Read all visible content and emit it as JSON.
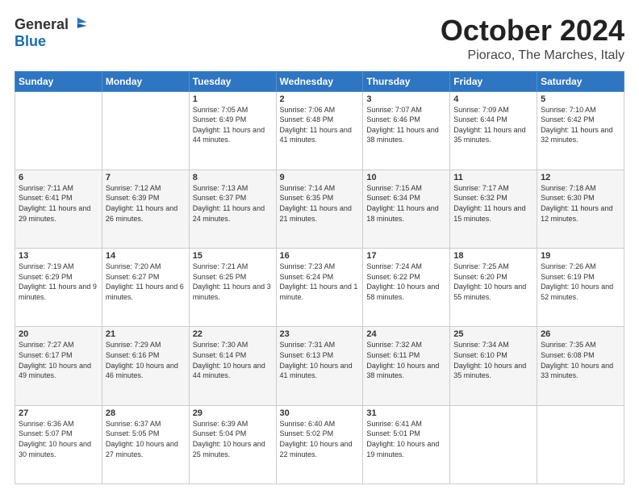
{
  "header": {
    "logo_general": "General",
    "logo_blue": "Blue",
    "title": "October 2024",
    "location": "Pioraco, The Marches, Italy"
  },
  "days_of_week": [
    "Sunday",
    "Monday",
    "Tuesday",
    "Wednesday",
    "Thursday",
    "Friday",
    "Saturday"
  ],
  "weeks": [
    [
      {
        "day": "",
        "sunrise": "",
        "sunset": "",
        "daylight": ""
      },
      {
        "day": "",
        "sunrise": "",
        "sunset": "",
        "daylight": ""
      },
      {
        "day": "1",
        "sunrise": "Sunrise: 7:05 AM",
        "sunset": "Sunset: 6:49 PM",
        "daylight": "Daylight: 11 hours and 44 minutes."
      },
      {
        "day": "2",
        "sunrise": "Sunrise: 7:06 AM",
        "sunset": "Sunset: 6:48 PM",
        "daylight": "Daylight: 11 hours and 41 minutes."
      },
      {
        "day": "3",
        "sunrise": "Sunrise: 7:07 AM",
        "sunset": "Sunset: 6:46 PM",
        "daylight": "Daylight: 11 hours and 38 minutes."
      },
      {
        "day": "4",
        "sunrise": "Sunrise: 7:09 AM",
        "sunset": "Sunset: 6:44 PM",
        "daylight": "Daylight: 11 hours and 35 minutes."
      },
      {
        "day": "5",
        "sunrise": "Sunrise: 7:10 AM",
        "sunset": "Sunset: 6:42 PM",
        "daylight": "Daylight: 11 hours and 32 minutes."
      }
    ],
    [
      {
        "day": "6",
        "sunrise": "Sunrise: 7:11 AM",
        "sunset": "Sunset: 6:41 PM",
        "daylight": "Daylight: 11 hours and 29 minutes."
      },
      {
        "day": "7",
        "sunrise": "Sunrise: 7:12 AM",
        "sunset": "Sunset: 6:39 PM",
        "daylight": "Daylight: 11 hours and 26 minutes."
      },
      {
        "day": "8",
        "sunrise": "Sunrise: 7:13 AM",
        "sunset": "Sunset: 6:37 PM",
        "daylight": "Daylight: 11 hours and 24 minutes."
      },
      {
        "day": "9",
        "sunrise": "Sunrise: 7:14 AM",
        "sunset": "Sunset: 6:35 PM",
        "daylight": "Daylight: 11 hours and 21 minutes."
      },
      {
        "day": "10",
        "sunrise": "Sunrise: 7:15 AM",
        "sunset": "Sunset: 6:34 PM",
        "daylight": "Daylight: 11 hours and 18 minutes."
      },
      {
        "day": "11",
        "sunrise": "Sunrise: 7:17 AM",
        "sunset": "Sunset: 6:32 PM",
        "daylight": "Daylight: 11 hours and 15 minutes."
      },
      {
        "day": "12",
        "sunrise": "Sunrise: 7:18 AM",
        "sunset": "Sunset: 6:30 PM",
        "daylight": "Daylight: 11 hours and 12 minutes."
      }
    ],
    [
      {
        "day": "13",
        "sunrise": "Sunrise: 7:19 AM",
        "sunset": "Sunset: 6:29 PM",
        "daylight": "Daylight: 11 hours and 9 minutes."
      },
      {
        "day": "14",
        "sunrise": "Sunrise: 7:20 AM",
        "sunset": "Sunset: 6:27 PM",
        "daylight": "Daylight: 11 hours and 6 minutes."
      },
      {
        "day": "15",
        "sunrise": "Sunrise: 7:21 AM",
        "sunset": "Sunset: 6:25 PM",
        "daylight": "Daylight: 11 hours and 3 minutes."
      },
      {
        "day": "16",
        "sunrise": "Sunrise: 7:23 AM",
        "sunset": "Sunset: 6:24 PM",
        "daylight": "Daylight: 11 hours and 1 minute."
      },
      {
        "day": "17",
        "sunrise": "Sunrise: 7:24 AM",
        "sunset": "Sunset: 6:22 PM",
        "daylight": "Daylight: 10 hours and 58 minutes."
      },
      {
        "day": "18",
        "sunrise": "Sunrise: 7:25 AM",
        "sunset": "Sunset: 6:20 PM",
        "daylight": "Daylight: 10 hours and 55 minutes."
      },
      {
        "day": "19",
        "sunrise": "Sunrise: 7:26 AM",
        "sunset": "Sunset: 6:19 PM",
        "daylight": "Daylight: 10 hours and 52 minutes."
      }
    ],
    [
      {
        "day": "20",
        "sunrise": "Sunrise: 7:27 AM",
        "sunset": "Sunset: 6:17 PM",
        "daylight": "Daylight: 10 hours and 49 minutes."
      },
      {
        "day": "21",
        "sunrise": "Sunrise: 7:29 AM",
        "sunset": "Sunset: 6:16 PM",
        "daylight": "Daylight: 10 hours and 46 minutes."
      },
      {
        "day": "22",
        "sunrise": "Sunrise: 7:30 AM",
        "sunset": "Sunset: 6:14 PM",
        "daylight": "Daylight: 10 hours and 44 minutes."
      },
      {
        "day": "23",
        "sunrise": "Sunrise: 7:31 AM",
        "sunset": "Sunset: 6:13 PM",
        "daylight": "Daylight: 10 hours and 41 minutes."
      },
      {
        "day": "24",
        "sunrise": "Sunrise: 7:32 AM",
        "sunset": "Sunset: 6:11 PM",
        "daylight": "Daylight: 10 hours and 38 minutes."
      },
      {
        "day": "25",
        "sunrise": "Sunrise: 7:34 AM",
        "sunset": "Sunset: 6:10 PM",
        "daylight": "Daylight: 10 hours and 35 minutes."
      },
      {
        "day": "26",
        "sunrise": "Sunrise: 7:35 AM",
        "sunset": "Sunset: 6:08 PM",
        "daylight": "Daylight: 10 hours and 33 minutes."
      }
    ],
    [
      {
        "day": "27",
        "sunrise": "Sunrise: 6:36 AM",
        "sunset": "Sunset: 5:07 PM",
        "daylight": "Daylight: 10 hours and 30 minutes."
      },
      {
        "day": "28",
        "sunrise": "Sunrise: 6:37 AM",
        "sunset": "Sunset: 5:05 PM",
        "daylight": "Daylight: 10 hours and 27 minutes."
      },
      {
        "day": "29",
        "sunrise": "Sunrise: 6:39 AM",
        "sunset": "Sunset: 5:04 PM",
        "daylight": "Daylight: 10 hours and 25 minutes."
      },
      {
        "day": "30",
        "sunrise": "Sunrise: 6:40 AM",
        "sunset": "Sunset: 5:02 PM",
        "daylight": "Daylight: 10 hours and 22 minutes."
      },
      {
        "day": "31",
        "sunrise": "Sunrise: 6:41 AM",
        "sunset": "Sunset: 5:01 PM",
        "daylight": "Daylight: 10 hours and 19 minutes."
      },
      {
        "day": "",
        "sunrise": "",
        "sunset": "",
        "daylight": ""
      },
      {
        "day": "",
        "sunrise": "",
        "sunset": "",
        "daylight": ""
      }
    ]
  ]
}
